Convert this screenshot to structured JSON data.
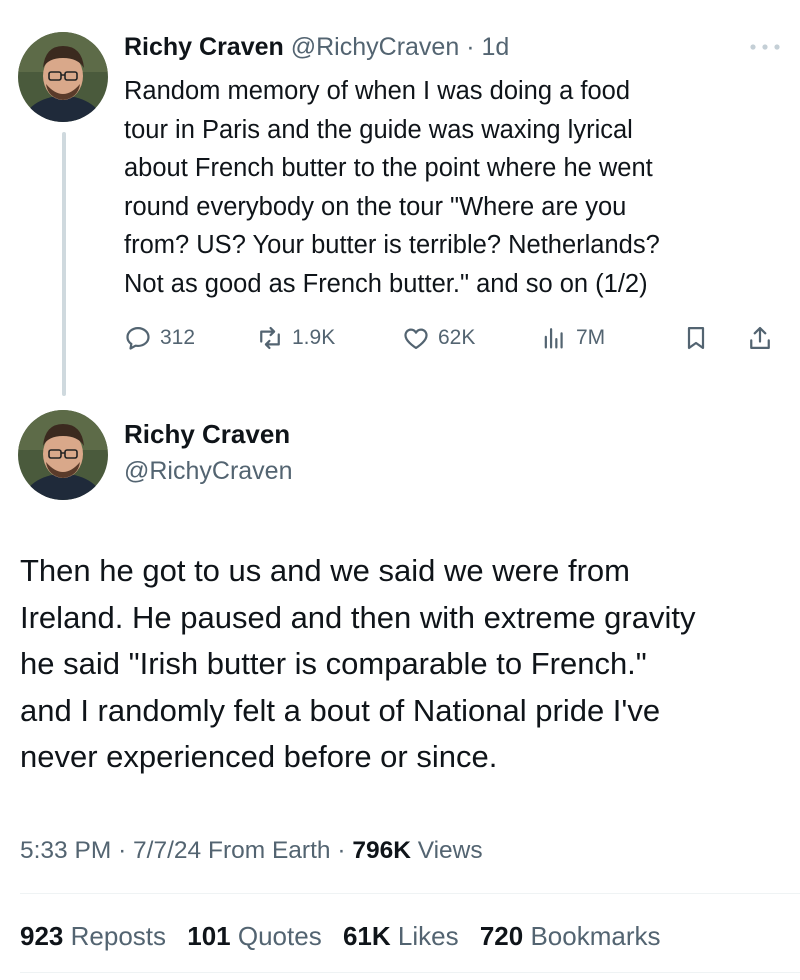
{
  "tweet1": {
    "author_name": "Richy Craven",
    "handle": "@RichyCraven",
    "separator": "·",
    "age": "1d",
    "text_lines": [
      "Random memory of when I was doing a food",
      "tour in Paris and the guide was waxing lyrical",
      "about French butter to the point where he went",
      "round everybody on the tour \"Where are you",
      "from? US? Your butter is terrible? Netherlands?",
      "Not as good as French butter.\" and so on (1/2)"
    ],
    "actions": {
      "replies": "312",
      "reposts": "1.9K",
      "likes": "62K",
      "views": "7M"
    },
    "more_icon": "more-horizontal-icon"
  },
  "tweet2": {
    "author_name": "Richy Craven",
    "handle": "@RichyCraven",
    "text_lines": [
      "Then he got to us and we said we were from",
      "Ireland. He paused and then with extreme gravity",
      "he said \"Irish butter is comparable to French.\"",
      "and I randomly felt a bout of National pride I've",
      "never experienced before or since."
    ],
    "meta": {
      "time": "5:33 PM",
      "sep1": "·",
      "date": "7/7/24",
      "source": "From Earth",
      "sep2": "·",
      "views_count": "796K",
      "views_label": "Views"
    },
    "stats": {
      "reposts_count": "923",
      "reposts_label": "Reposts",
      "quotes_count": "101",
      "quotes_label": "Quotes",
      "likes_count": "61K",
      "likes_label": "Likes",
      "bookmarks_count": "720",
      "bookmarks_label": "Bookmarks"
    }
  },
  "colors": {
    "text": "#0f1419",
    "muted": "#536471",
    "thread_line": "#cfd9de",
    "divider": "#eff3f4"
  }
}
